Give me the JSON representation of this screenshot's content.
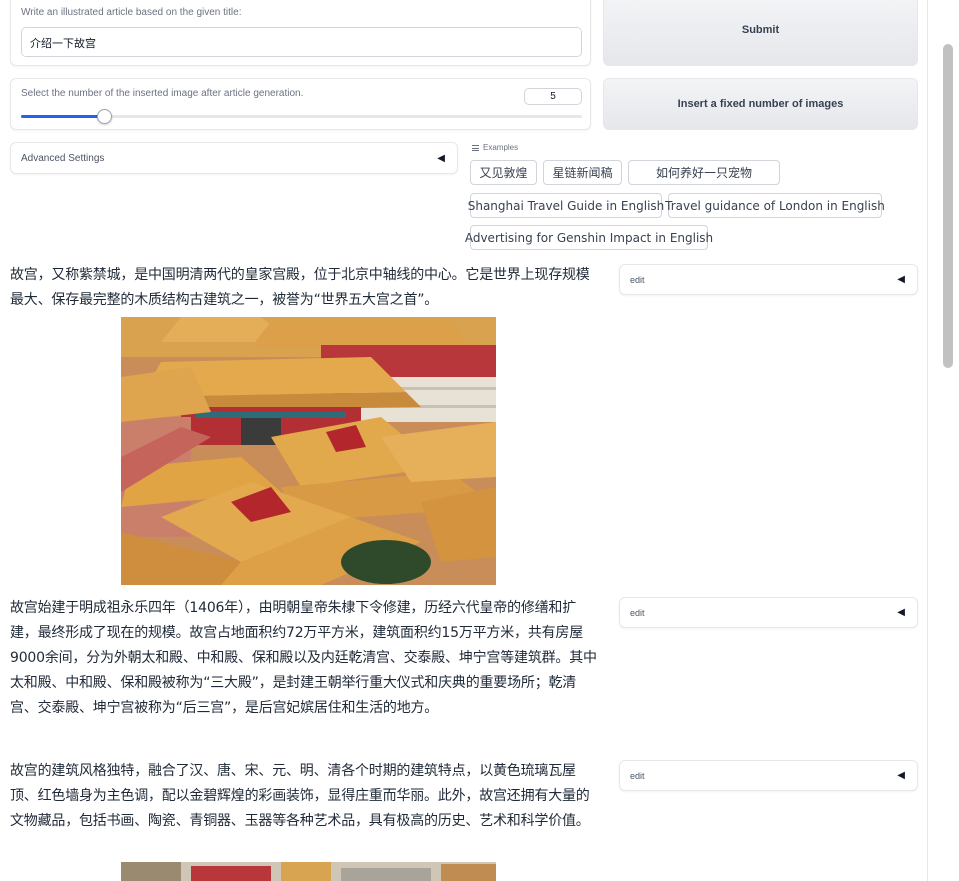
{
  "prompt": {
    "label": "Write an illustrated article based on the given title:",
    "value": "介绍一下故宫"
  },
  "submit_label": "Submit",
  "slider": {
    "label": "Select the number of the inserted image after article generation.",
    "value": "5",
    "fraction": 0.148
  },
  "insert_label": "Insert a fixed number of images",
  "advanced_label": "Advanced Settings",
  "caret": "◀",
  "examples": {
    "label": "Examples",
    "items": [
      "又见敦煌",
      "星链新闻稿",
      "如何养好一只宠物",
      "Shanghai Travel Guide in English",
      "Travel guidance of London in English",
      "Advertising for Genshin Impact in English"
    ]
  },
  "article": {
    "paragraphs": [
      "故宫，又称紫禁城，是中国明清两代的皇家宫殿，位于北京中轴线的中心。它是世界上现存规模最大、保存最完整的木质结构古建筑之一，被誉为“世界五大宫之首”。",
      "故宫始建于明成祖永乐四年（1406年），由明朝皇帝朱棣下令修建，历经六代皇帝的修缮和扩建，最终形成了现在的规模。故宫占地面积约72万平方米，建筑面积约15万平方米，共有房屋9000余间，分为外朝太和殿、中和殿、保和殿以及内廷乾清宫、交泰殿、坤宁宫等建筑群。其中太和殿、中和殿、保和殿被称为“三大殿”，是封建王朝举行重大仪式和庆典的重要场所；乾清宫、交泰殿、坤宁宫被称为“后三宫”，是后宫妃嫔居住和生活的地方。",
      "故宫的建筑风格独特，融合了汉、唐、宋、元、明、清各个时期的建筑特点，以黄色琉璃瓦屋顶、红色墙身为主色调，配以金碧辉煌的彩画装饰，显得庄重而华丽。此外，故宫还拥有大量的文物藏品，包括书画、陶瓷、青铜器、玉器等各种艺术品，具有极高的历史、艺术和科学价值。"
    ],
    "edit_label": "edit"
  },
  "colors": {
    "accent": "#2563eb",
    "roof_gold": "#e0a84a",
    "wall_red": "#b8323a"
  }
}
